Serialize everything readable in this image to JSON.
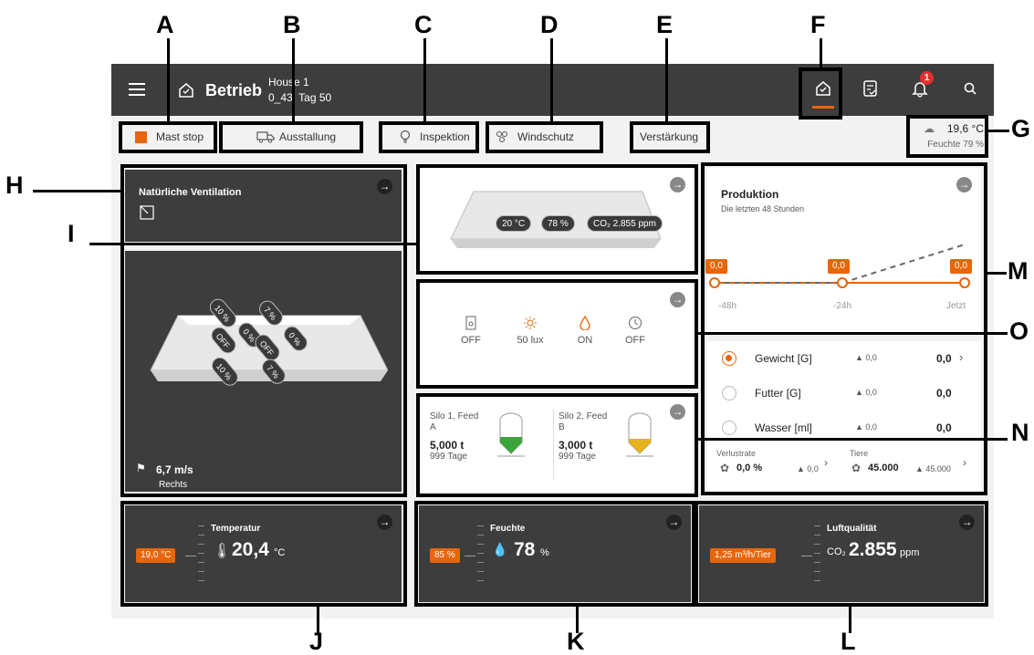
{
  "callouts": [
    "A",
    "B",
    "C",
    "D",
    "E",
    "F",
    "G",
    "H",
    "I",
    "J",
    "K",
    "L",
    "M",
    "N",
    "O"
  ],
  "topbar": {
    "menu_icon": "hamburger-icon",
    "page_icon": "house-check-icon",
    "title": "Betrieb",
    "house": "House 1",
    "subtitle": "0_43, Tag 50",
    "icons": [
      "dashboard-icon",
      "checklist-icon",
      "bell-icon",
      "search-icon"
    ],
    "notification_count": "1"
  },
  "tabs": {
    "mast_stop": "Mast stop",
    "ausstallung": "Ausstallung",
    "inspektion": "Inspektion",
    "windschutz": "Windschutz",
    "verstaerkung": "Verstärkung"
  },
  "weather": {
    "temp": "19,6 °C",
    "humidity": "Feuchte 79 %"
  },
  "ventilation": {
    "title": "Natürliche Ventilation",
    "flaps": [
      "10 %",
      "7 %",
      "OFF",
      "0 %",
      "OFF",
      "0 %",
      "10 %",
      "7 %"
    ],
    "wind_speed": "6,7 m/s",
    "wind_dir": "Rechts"
  },
  "house_climate": {
    "temp": "20 °C",
    "humidity": "78 %",
    "co2": "CO₂ 2.855 ppm"
  },
  "devices": [
    {
      "label": "OFF",
      "icon": "feeder-icon"
    },
    {
      "label": "50 lux",
      "icon": "light-icon"
    },
    {
      "label": "ON",
      "icon": "water-drop-icon"
    },
    {
      "label": "OFF",
      "icon": "clock-icon"
    }
  ],
  "silos": [
    {
      "name": "Silo 1, Feed A",
      "amount": "5,000 t",
      "days": "999 Tage",
      "level": 0.3,
      "color": "#3aa53a"
    },
    {
      "name": "Silo 2, Feed B",
      "amount": "3,000 t",
      "days": "999 Tage",
      "level": 0.25,
      "color": "#e6b21e"
    }
  ],
  "production": {
    "title": "Produktion",
    "subtitle": "Die letzten 48 Stunden",
    "points": [
      "0,0",
      "0,0",
      "0,0"
    ],
    "axis": [
      "-48h",
      "-24h",
      "Jetzt"
    ],
    "rows": [
      {
        "label": "Gewicht [G]",
        "delta": "▲ 0,0",
        "value": "0,0",
        "selected": true
      },
      {
        "label": "Futter [G]",
        "delta": "▲ 0,0",
        "value": "0,0",
        "selected": false
      },
      {
        "label": "Wasser [ml]",
        "delta": "▲ 0,0",
        "value": "0,0",
        "selected": false
      }
    ],
    "loss_label": "Verlustrate",
    "loss_value": "0,0 %",
    "loss_delta": "▲ 0,0",
    "animals_label": "Tiere",
    "animals_value": "45.000",
    "animals_delta": "▲ 45.000"
  },
  "bottom": {
    "temperature": {
      "title": "Temperatur",
      "tag": "19,0 °C",
      "value": "20,4",
      "unit": "°C"
    },
    "humidity": {
      "title": "Feuchte",
      "tag": "85 %",
      "value": "78",
      "unit": "%"
    },
    "air": {
      "title": "Luftqualität",
      "tag": "1,25 m³/h/Tier",
      "prefix": "CO₂",
      "value": "2.855",
      "unit": "ppm"
    }
  },
  "colors": {
    "accent": "#e8650a",
    "topbar": "#3d3d3d"
  }
}
